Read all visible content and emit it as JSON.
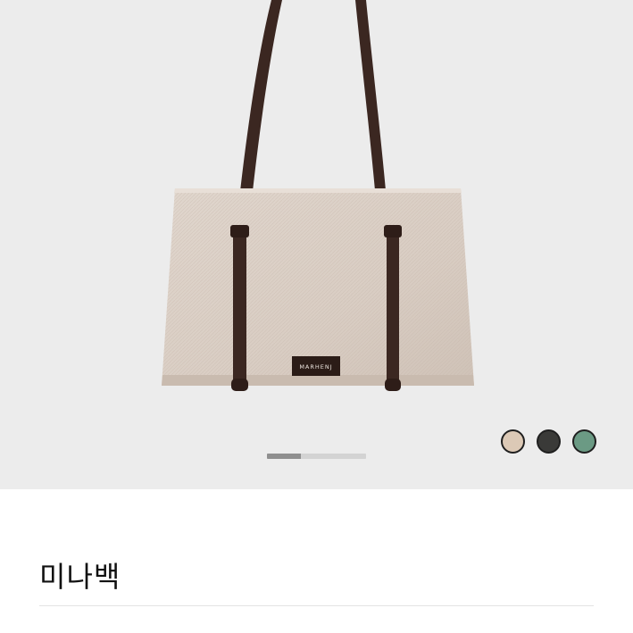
{
  "gallery": {
    "brand_label": "MARHENJ",
    "slide_progress": 0.34,
    "colors": {
      "background": "#ececec",
      "canvas": "#dcd1c8",
      "leather": "#3b2721"
    }
  },
  "color_options": [
    {
      "name": "beige",
      "hex": "#dcc9b6"
    },
    {
      "name": "charcoal",
      "hex": "#3a3a38"
    },
    {
      "name": "green",
      "hex": "#6b9a84"
    }
  ],
  "product": {
    "title": "미나백"
  }
}
